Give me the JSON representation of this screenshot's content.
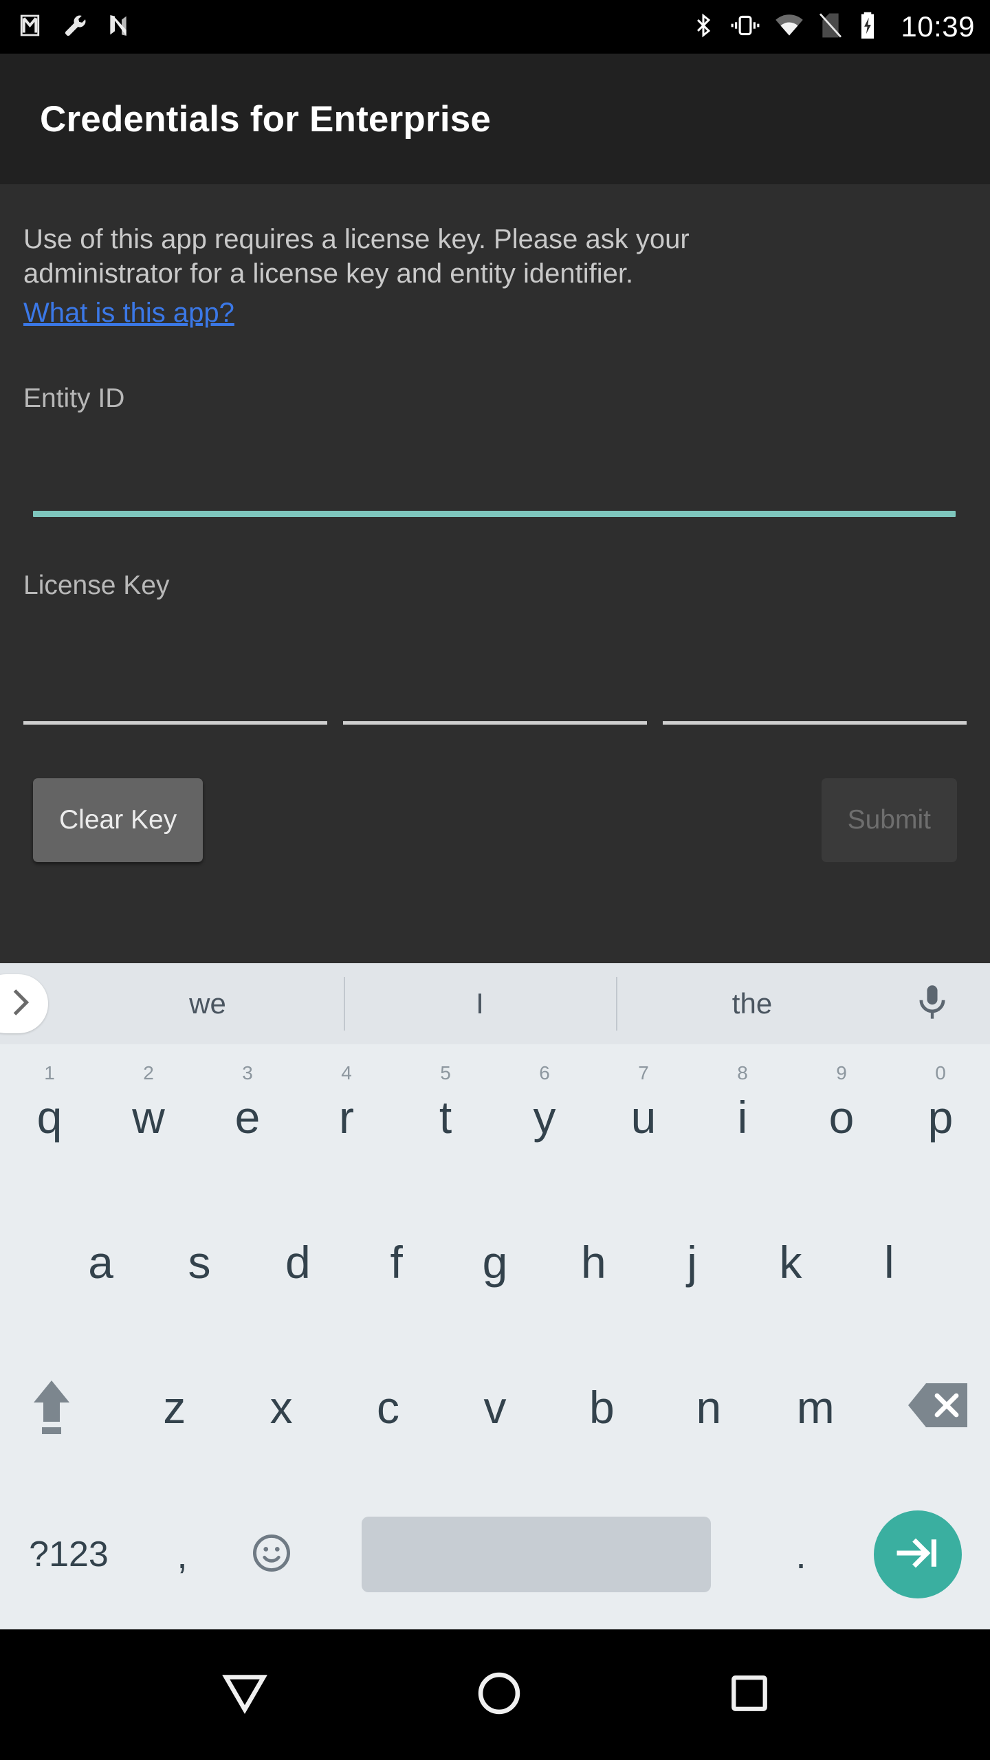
{
  "status_bar": {
    "left_icons": [
      "gmail-icon",
      "wrench-icon",
      "n-logo-icon"
    ],
    "right_icons": [
      "bluetooth-icon",
      "vibrate-icon",
      "wifi-icon",
      "no-sim-icon",
      "battery-charging-icon"
    ],
    "time": "10:39"
  },
  "app_bar": {
    "title": "Credentials for Enterprise"
  },
  "content": {
    "description": "Use of this app requires a license key. Please ask your administrator for a license key and entity identifier.",
    "link_label": "What is this app?",
    "entity": {
      "label": "Entity ID",
      "value": "",
      "placeholder": "",
      "focused": true,
      "accent_color": "#7ec6bd"
    },
    "license": {
      "label": "License Key",
      "segments": [
        {
          "value": "",
          "placeholder": ""
        },
        {
          "value": "",
          "placeholder": ""
        },
        {
          "value": "",
          "placeholder": ""
        }
      ],
      "underline_color": "#cfcfcf"
    },
    "buttons": {
      "clear_label": "Clear Key",
      "submit_label": "Submit",
      "submit_enabled": false
    },
    "background_color": "#2e2e2e",
    "link_color": "#3b78e7"
  },
  "keyboard": {
    "expand_icon": "chevron-right-icon",
    "suggestions": [
      "we",
      "I",
      "the"
    ],
    "mic_icon": "microphone-icon",
    "row1": [
      {
        "letter": "q",
        "num": "1"
      },
      {
        "letter": "w",
        "num": "2"
      },
      {
        "letter": "e",
        "num": "3"
      },
      {
        "letter": "r",
        "num": "4"
      },
      {
        "letter": "t",
        "num": "5"
      },
      {
        "letter": "y",
        "num": "6"
      },
      {
        "letter": "u",
        "num": "7"
      },
      {
        "letter": "i",
        "num": "8"
      },
      {
        "letter": "o",
        "num": "9"
      },
      {
        "letter": "p",
        "num": "0"
      }
    ],
    "row2": [
      "a",
      "s",
      "d",
      "f",
      "g",
      "h",
      "j",
      "k",
      "l"
    ],
    "row3": {
      "shift_icon": "shift-up-arrow-icon",
      "letters": [
        "z",
        "x",
        "c",
        "v",
        "b",
        "n",
        "m"
      ],
      "backspace_icon": "backspace-icon"
    },
    "row4": {
      "symbols_label": "?123",
      "comma": ",",
      "emoji_icon": "emoji-smiley-icon",
      "space_label": "",
      "period": ".",
      "enter_icon": "tab-next-arrow-icon",
      "enter_color": "#3aafa0"
    },
    "background_color": "#e9edf0",
    "suggestion_bar_color": "#e1e5e9"
  },
  "nav_bar": {
    "back_icon": "keyboard-dismiss-down-triangle-icon",
    "home_icon": "home-circle-icon",
    "recents_icon": "recents-square-icon"
  }
}
